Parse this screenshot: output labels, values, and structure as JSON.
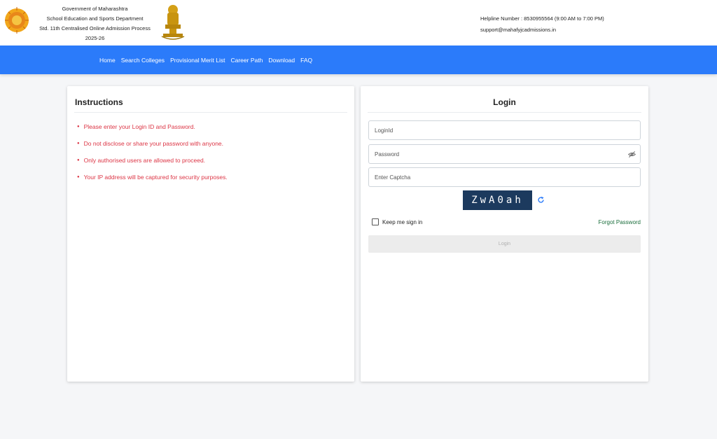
{
  "header": {
    "line1": "Government of Maharashtra",
    "line2": "School Education and Sports Department",
    "line3": "Std. 11th Centralised Online Admission Process 2025-26",
    "helpline": "Helpline Number : 8530955564 (9:00 AM to 7:00 PM)",
    "email": "support@mahafyjcadmissions.in",
    "left_emblem_icon": "maharashtra-seal-icon",
    "right_emblem_icon": "national-emblem-icon"
  },
  "nav": {
    "items": [
      "Home",
      "Search Colleges",
      "Provisional Merit List",
      "Career Path",
      "Download",
      "FAQ"
    ]
  },
  "instructions": {
    "title": "Instructions",
    "items": [
      "Please enter your Login ID and Password.",
      "Do not disclose or share your password with anyone.",
      "Only authorised users are allowed to proceed.",
      "Your IP address will be captured for security purposes."
    ]
  },
  "login": {
    "title": "Login",
    "loginid_placeholder": "LoginId",
    "password_placeholder": "Password",
    "captcha_placeholder": "Enter Captcha",
    "captcha_text": "ZwA0ah",
    "keep_signed_in": "Keep me sign in",
    "forgot_password": "Forgot Password",
    "submit_label": "Login"
  },
  "colors": {
    "nav_bg": "#2b7bfa",
    "instruction_text": "#dc3545",
    "captcha_bg": "#1c3a5e",
    "forgot_link": "#1b6e3c"
  }
}
